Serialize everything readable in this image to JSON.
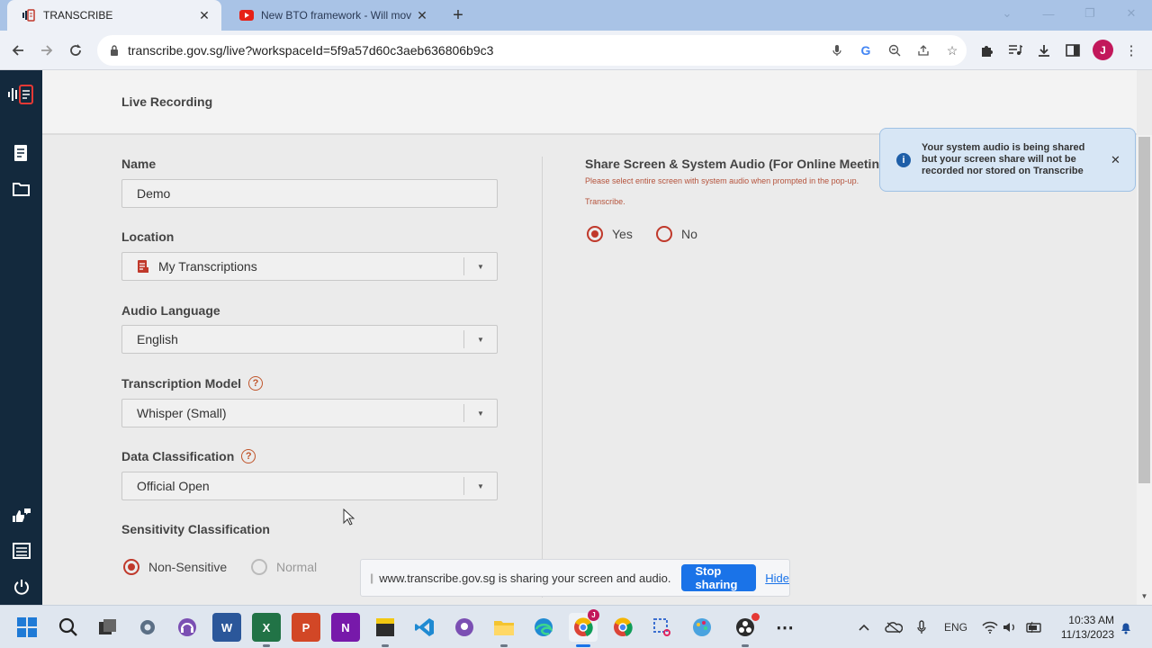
{
  "browser": {
    "tabs": [
      {
        "title": "TRANSCRIBE",
        "close": "✕"
      },
      {
        "title": "New BTO framework - Will mov",
        "close": "✕"
      }
    ],
    "new_tab": "+",
    "url": "transcribe.gov.sg/live?workspaceId=5f9a57d60c3aeb636806b9c3",
    "profile_initial": "J"
  },
  "page": {
    "title": "Live Recording"
  },
  "form": {
    "name_label": "Name",
    "name_value": "Demo",
    "location_label": "Location",
    "location_value": "My Transcriptions",
    "audio_language_label": "Audio Language",
    "audio_language_value": "English",
    "transcription_model_label": "Transcription Model",
    "transcription_model_value": "Whisper (Small)",
    "data_classification_label": "Data Classification",
    "data_classification_value": "Official Open",
    "sensitivity_label": "Sensitivity Classification",
    "sensitivity_options": [
      {
        "label": "Non-Sensitive",
        "selected": true,
        "disabled": false
      },
      {
        "label": "Normal",
        "selected": false,
        "disabled": true
      }
    ],
    "help_glyph": "?"
  },
  "share": {
    "title": "Share Screen & System Audio (For Online Meetings)",
    "hint_line1": "Please select entire screen with system audio when prompted in the pop-up.",
    "hint_line2": "Transcribe.",
    "options": [
      {
        "label": "Yes",
        "selected": true
      },
      {
        "label": "No",
        "selected": false
      }
    ]
  },
  "toast": {
    "message": "Your system audio is being shared but your screen share will not be recorded nor stored on Transcribe",
    "close": "✕",
    "info_glyph": "i"
  },
  "sharebar": {
    "message": "www.transcribe.gov.sg is sharing your screen and audio.",
    "stop_label": "Stop sharing",
    "hide_label": "Hide"
  },
  "taskbar": {
    "language": "ENG",
    "time": "10:33 AM",
    "date": "11/13/2023",
    "chrome_badge": "J"
  },
  "colors": {
    "accent": "#c0392b",
    "rail": "#13293d",
    "primary_button": "#1a73e8"
  }
}
